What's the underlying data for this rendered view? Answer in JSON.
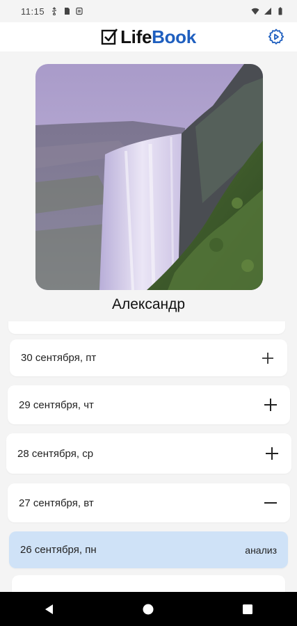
{
  "status_bar": {
    "time": "11:15",
    "left_icons": [
      "usb-icon",
      "sd-card-icon",
      "storage-icon"
    ],
    "right_icons": [
      "wifi-icon",
      "signal-icon",
      "battery-icon"
    ]
  },
  "app_bar": {
    "logo_part1": "Life",
    "logo_part2": "Book",
    "brand_color": "#1f5fbf",
    "settings_icon": "settings-icon"
  },
  "profile": {
    "name": "Александр",
    "photo": "waterfall-photo"
  },
  "days": [
    {
      "label": "30 сентября, пт",
      "action": "plus"
    },
    {
      "label": "29 сентября, чт",
      "action": "plus"
    },
    {
      "label": "28 сентября, ср",
      "action": "plus"
    },
    {
      "label": "27 сентября, вт",
      "action": "minus"
    },
    {
      "label": "26 сентября, пн",
      "action_label": "анализ",
      "selected": true
    }
  ],
  "selected_color": "#cfe2f7",
  "nav_bar": [
    "back-icon",
    "home-icon",
    "recents-icon"
  ]
}
